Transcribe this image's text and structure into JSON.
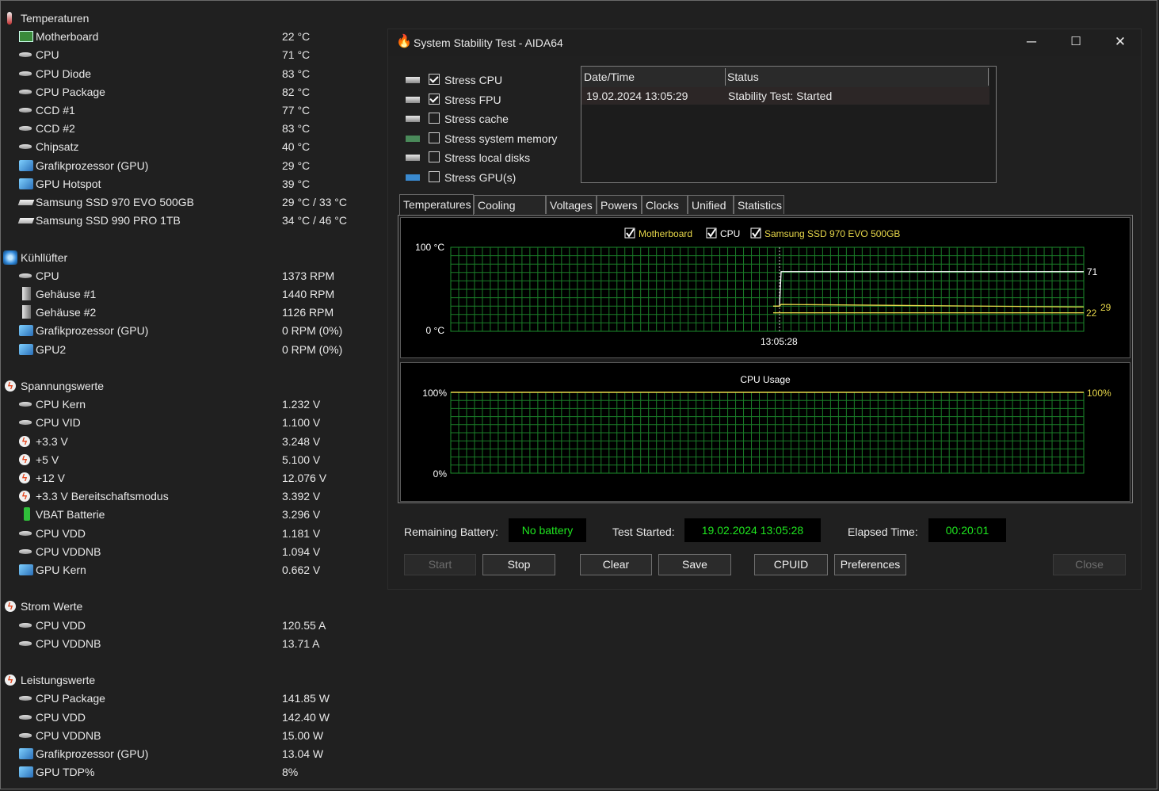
{
  "sensors": {
    "groups": [
      {
        "title": "Temperaturen",
        "icon": "thermometer-icon",
        "items": [
          {
            "label": "Motherboard",
            "value": "22 °C",
            "icon": "motherboard-icon"
          },
          {
            "label": "CPU",
            "value": "71 °C",
            "icon": "chip-icon"
          },
          {
            "label": "CPU Diode",
            "value": "83 °C",
            "icon": "chip-icon"
          },
          {
            "label": "CPU Package",
            "value": "82 °C",
            "icon": "chip-icon"
          },
          {
            "label": "CCD #1",
            "value": "77 °C",
            "icon": "chip-icon"
          },
          {
            "label": "CCD #2",
            "value": "83 °C",
            "icon": "chip-icon"
          },
          {
            "label": "Chipsatz",
            "value": "40 °C",
            "icon": "chip-icon"
          },
          {
            "label": "Grafikprozessor (GPU)",
            "value": "29 °C",
            "icon": "gpu-icon"
          },
          {
            "label": "GPU Hotspot",
            "value": "39 °C",
            "icon": "gpu-icon"
          },
          {
            "label": "Samsung SSD 970 EVO 500GB",
            "value": "29 °C / 33 °C",
            "icon": "disk-icon"
          },
          {
            "label": "Samsung SSD 990 PRO 1TB",
            "value": "34 °C / 46 °C",
            "icon": "disk-icon"
          }
        ]
      },
      {
        "title": "Kühllüfter",
        "icon": "fan-icon",
        "items": [
          {
            "label": "CPU",
            "value": "1373 RPM",
            "icon": "chip-icon"
          },
          {
            "label": "Gehäuse #1",
            "value": "1440 RPM",
            "icon": "case-icon"
          },
          {
            "label": "Gehäuse #2",
            "value": "1126 RPM",
            "icon": "case-icon"
          },
          {
            "label": "Grafikprozessor (GPU)",
            "value": "0 RPM  (0%)",
            "icon": "gpu-icon"
          },
          {
            "label": "GPU2",
            "value": "0 RPM  (0%)",
            "icon": "gpu-icon"
          }
        ]
      },
      {
        "title": "Spannungswerte",
        "icon": "voltage-icon",
        "items": [
          {
            "label": "CPU Kern",
            "value": "1.232 V",
            "icon": "chip-icon"
          },
          {
            "label": "CPU VID",
            "value": "1.100 V",
            "icon": "chip-icon"
          },
          {
            "label": "+3.3 V",
            "value": "3.248 V",
            "icon": "voltage-icon"
          },
          {
            "label": "+5 V",
            "value": "5.100 V",
            "icon": "voltage-icon"
          },
          {
            "label": "+12 V",
            "value": "12.076 V",
            "icon": "voltage-icon"
          },
          {
            "label": "+3.3 V Bereitschaftsmodus",
            "value": "3.392 V",
            "icon": "voltage-icon"
          },
          {
            "label": "VBAT Batterie",
            "value": "3.296 V",
            "icon": "battery-icon"
          },
          {
            "label": "CPU VDD",
            "value": "1.181 V",
            "icon": "chip-icon"
          },
          {
            "label": "CPU VDDNB",
            "value": "1.094 V",
            "icon": "chip-icon"
          },
          {
            "label": "GPU Kern",
            "value": "0.662 V",
            "icon": "gpu-icon"
          }
        ]
      },
      {
        "title": "Strom Werte",
        "icon": "voltage-icon",
        "items": [
          {
            "label": "CPU VDD",
            "value": "120.55 A",
            "icon": "chip-icon"
          },
          {
            "label": "CPU VDDNB",
            "value": "13.71 A",
            "icon": "chip-icon"
          }
        ]
      },
      {
        "title": "Leistungswerte",
        "icon": "voltage-icon",
        "items": [
          {
            "label": "CPU Package",
            "value": "141.85 W",
            "icon": "chip-icon"
          },
          {
            "label": "CPU VDD",
            "value": "142.40 W",
            "icon": "chip-icon"
          },
          {
            "label": "CPU VDDNB",
            "value": "15.00 W",
            "icon": "chip-icon"
          },
          {
            "label": "Grafikprozessor (GPU)",
            "value": "13.04 W",
            "icon": "gpu-icon"
          },
          {
            "label": "GPU TDP%",
            "value": "8%",
            "icon": "gpu-icon"
          }
        ]
      }
    ]
  },
  "window": {
    "title": "System Stability Test - AIDA64",
    "controls": {
      "minimize": "─",
      "maximize": "☐",
      "close": "✕"
    }
  },
  "stress_options": [
    {
      "label": "Stress CPU",
      "checked": true,
      "icon": "cpu-icon"
    },
    {
      "label": "Stress FPU",
      "checked": true,
      "icon": "fpu-icon"
    },
    {
      "label": "Stress cache",
      "checked": false,
      "icon": "cache-icon"
    },
    {
      "label": "Stress system memory",
      "checked": false,
      "icon": "memory-icon"
    },
    {
      "label": "Stress local disks",
      "checked": false,
      "icon": "disk-icon"
    },
    {
      "label": "Stress GPU(s)",
      "checked": false,
      "icon": "gpu-icon"
    }
  ],
  "log": {
    "columns": [
      "Date/Time",
      "Status"
    ],
    "rows": [
      [
        "19.02.2024 13:05:29",
        "Stability Test: Started"
      ]
    ]
  },
  "tabs": [
    "Temperatures",
    "Cooling Fans",
    "Voltages",
    "Powers",
    "Clocks",
    "Unified",
    "Statistics"
  ],
  "active_tab": "Temperatures",
  "temp_graph": {
    "legend": [
      {
        "label": "Motherboard",
        "checked": true,
        "color": "#e8d84a"
      },
      {
        "label": "CPU",
        "checked": true,
        "color": "#ffffff"
      },
      {
        "label": "Samsung SSD 970 EVO 500GB",
        "checked": true,
        "color": "#e8d84a"
      }
    ],
    "y_max_label": "100 °C",
    "y_min_label": "0 °C",
    "x_marker_label": "13:05:28",
    "end_labels": [
      "71",
      "29",
      "22"
    ]
  },
  "usage_graph": {
    "title": "CPU Usage",
    "y_max_label": "100%",
    "y_min_label": "0%",
    "current_label": "100%"
  },
  "chart_data": [
    {
      "type": "line",
      "ylim": [
        0,
        100
      ],
      "series": [
        {
          "name": "CPU",
          "color": "#ffffff",
          "pre_test": 30,
          "at_test": 71,
          "current": 71
        },
        {
          "name": "Samsung SSD 970 EVO 500GB",
          "color": "#e8d84a",
          "pre_test": 30,
          "at_test": 32,
          "current": 29
        },
        {
          "name": "Motherboard",
          "color": "#e8d84a",
          "pre_test": 22,
          "at_test": 22,
          "current": 22
        }
      ]
    },
    {
      "type": "line",
      "title": "CPU Usage",
      "ylim": [
        0,
        100
      ],
      "series": [
        {
          "values": [
            100,
            100
          ]
        }
      ]
    }
  ],
  "status": {
    "remaining_battery_label": "Remaining Battery:",
    "remaining_battery_value": "No battery",
    "test_started_label": "Test Started:",
    "test_started_value": "19.02.2024 13:05:28",
    "elapsed_label": "Elapsed Time:",
    "elapsed_value": "00:20:01"
  },
  "buttons": {
    "start": "Start",
    "stop": "Stop",
    "clear": "Clear",
    "save": "Save",
    "cpuid": "CPUID",
    "preferences": "Preferences",
    "close": "Close"
  }
}
